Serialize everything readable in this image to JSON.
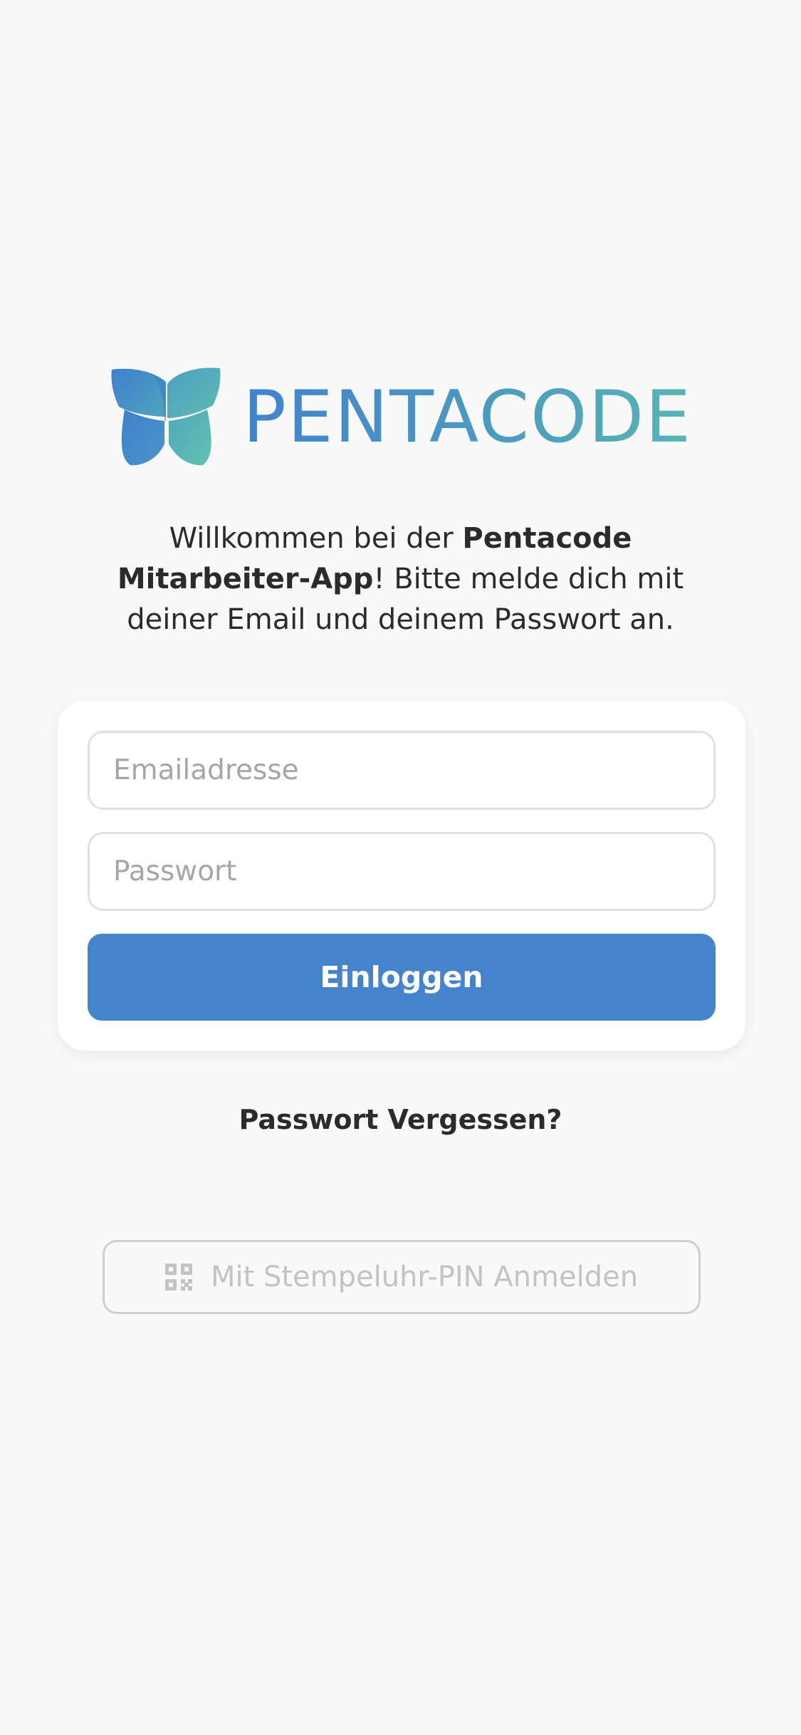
{
  "brand": {
    "name": "PENTACODE",
    "colors": {
      "blue": "#4083cf",
      "teal": "#58b5b4"
    },
    "icon": "butterfly-logo-icon"
  },
  "welcome": {
    "part1": "Willkommen bei der ",
    "app_name": "Pentacode Mitarbeiter-App",
    "part2": "! Bitte melde dich mit deiner Email und deinem Passwort an."
  },
  "login_form": {
    "email_placeholder": "Emailadresse",
    "password_placeholder": "Passwort",
    "submit_label": "Einloggen",
    "submit_color": "#4584cc"
  },
  "forgot_password_label": "Passwort Vergessen?",
  "pin_login": {
    "label": "Mit Stempeluhr-PIN Anmelden",
    "icon": "qr-code-icon"
  }
}
